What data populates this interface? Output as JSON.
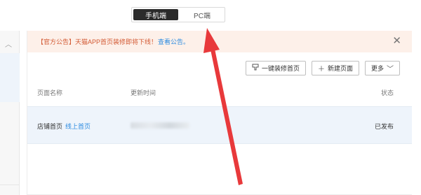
{
  "mode_switch": {
    "mobile_label": "手机端",
    "pc_label": "PC端"
  },
  "notice": {
    "text": "【官方公告】天猫APP首页装修即将下线！",
    "link_label": "查看公告。"
  },
  "toolbar": {
    "decorate_label": "一键装修首页",
    "new_page_label": "新建页面",
    "more_label": "更多"
  },
  "table": {
    "columns": {
      "name": "页面名称",
      "time": "更新时间",
      "status": "状态"
    },
    "rows": [
      {
        "name": "店铺首页",
        "online_link": "线上首页",
        "status": "已发布"
      }
    ]
  },
  "colors": {
    "accent": "#2c8be0",
    "notice_bg": "#fdf0e9",
    "notice_text": "#d35a34",
    "arrow": "#e8393b"
  }
}
